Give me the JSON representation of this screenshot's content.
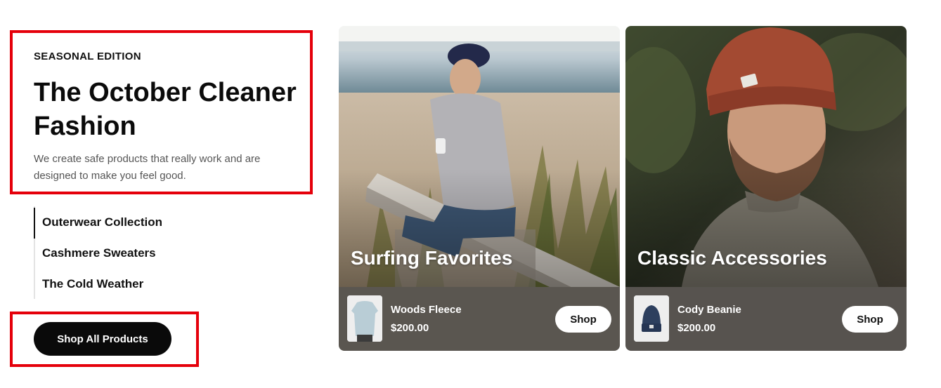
{
  "hero": {
    "eyebrow": "SEASONAL EDITION",
    "title": "The October Cleaner Fashion",
    "description": "We create safe products that really work and are designed to make you feel good."
  },
  "collections": {
    "items": [
      {
        "label": "Outerwear Collection",
        "active": true
      },
      {
        "label": "Cashmere Sweaters",
        "active": false
      },
      {
        "label": "The Cold Weather",
        "active": false
      }
    ]
  },
  "cta": {
    "label": "Shop All Products"
  },
  "cards": [
    {
      "title": "Surfing Favorites",
      "product": {
        "name": "Woods Fleece",
        "price": "$200.00",
        "thumb_icon": "fleece-sweater-icon"
      },
      "shop_label": "Shop"
    },
    {
      "title": "Classic Accessories",
      "product": {
        "name": "Cody Beanie",
        "price": "$200.00",
        "thumb_icon": "beanie-icon"
      },
      "shop_label": "Shop"
    }
  ],
  "colors": {
    "highlight": "#e5000b",
    "cta_background": "#0a0a0a",
    "card_footer": "#5a5650"
  }
}
